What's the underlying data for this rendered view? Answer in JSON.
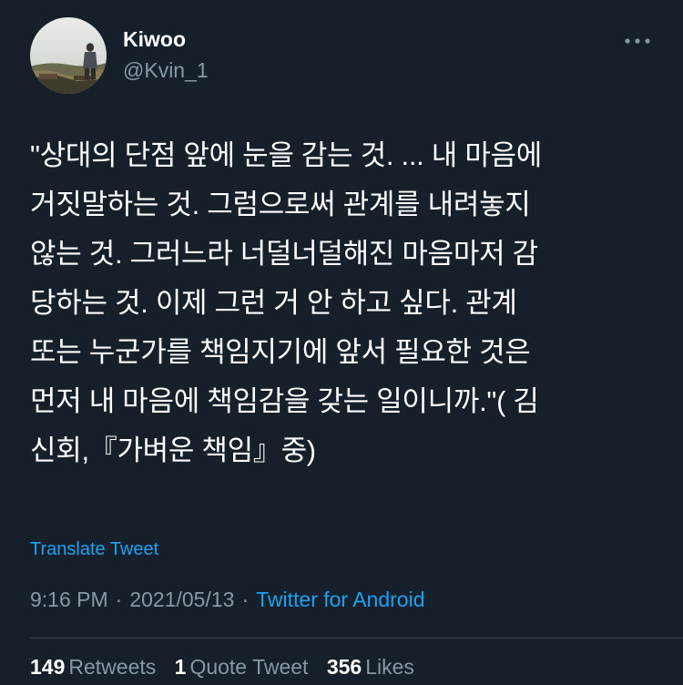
{
  "author": {
    "display_name": "Kiwoo",
    "handle": "@Kvin_1"
  },
  "icons": {
    "more": "more-horizontal-icon",
    "avatar": "profile-photo"
  },
  "tweet": {
    "text": "\"상대의 단점 앞에 눈을 감는 것. ... 내 마음에\n거짓말하는 것. 그럼으로써 관계를 내려놓지\n않는 것. 그러느라 너덜너덜해진 마음마저 감\n당하는 것. 이제 그런 거 안 하고 싶다. 관계\n또는 누군가를 책임지기에 앞서 필요한 것은\n먼저 내 마음에 책임감을 갖는 일이니까.\"( 김\n신회,『가벼운 책임』중)",
    "translate_label": "Translate Tweet"
  },
  "meta": {
    "time": "9:16 PM",
    "separator": "·",
    "date": "2021/05/13",
    "source": "Twitter for Android"
  },
  "stats": {
    "retweets_count": "149",
    "retweets_label": "Retweets",
    "quote_count": "1",
    "quote_label": "Quote Tweet",
    "likes_count": "356",
    "likes_label": "Likes"
  },
  "colors": {
    "background": "#15202b",
    "accent": "#1da1f2",
    "secondary_text": "#8899a6"
  }
}
